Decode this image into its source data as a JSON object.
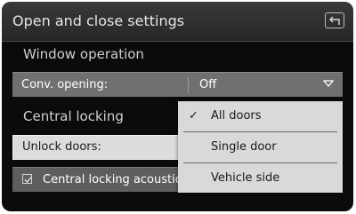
{
  "header": {
    "title": "Open and close settings",
    "back_icon": "back-arrow-icon"
  },
  "window_operation": {
    "heading": "Window operation",
    "conv_opening": {
      "label": "Conv. opening:",
      "value": "Off",
      "icon": "chevron-down-icon"
    }
  },
  "central_locking": {
    "heading": "Central locking",
    "unlock_doors": {
      "label": "Unlock doors:"
    },
    "acoustic": {
      "label": "Central locking acoustic",
      "checked": true
    }
  },
  "dropdown": {
    "options": [
      {
        "label": "All doors",
        "selected": true
      },
      {
        "label": "Single door",
        "selected": false
      },
      {
        "label": "Vehicle side",
        "selected": false
      }
    ],
    "check_glyph": "✓"
  }
}
